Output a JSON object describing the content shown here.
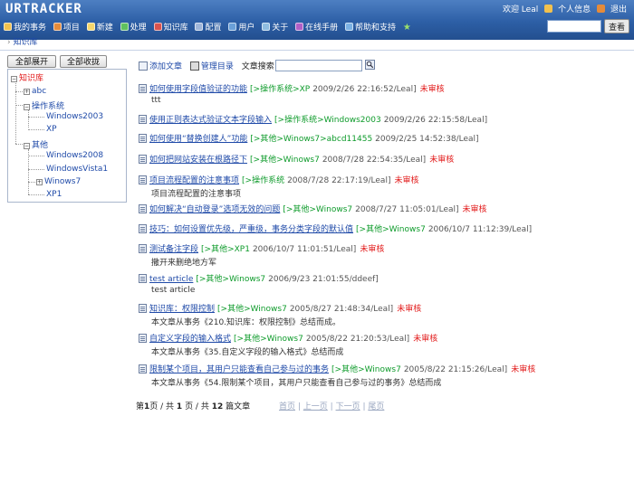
{
  "app": {
    "logo": "URTRACKER"
  },
  "userbar": {
    "welcome": "欢迎 Leal",
    "profile": "个人信息",
    "logout": "退出"
  },
  "nav": [
    {
      "label": "我的事务",
      "color": "#f2c14e"
    },
    {
      "label": "项目",
      "color": "#e58b3a"
    },
    {
      "label": "新建",
      "color": "#f6d76b"
    },
    {
      "label": "处理",
      "color": "#5fc15f"
    },
    {
      "label": "知识库",
      "color": "#d9534f"
    },
    {
      "label": "配置",
      "color": "#9fb6d9"
    },
    {
      "label": "用户",
      "color": "#6aa0d8"
    },
    {
      "label": "关于",
      "color": "#8fbde0"
    },
    {
      "label": "在线手册",
      "color": "#b05fc7"
    },
    {
      "label": "帮助和支持",
      "color": "#7bb1e3"
    }
  ],
  "search": {
    "button": "查看",
    "value": ""
  },
  "breadcrumb": "知识库",
  "tree": {
    "expand_all": "全部展开",
    "collapse_all": "全部收拢",
    "root": "知识库",
    "n_abc": "abc",
    "n_os": "操作系统",
    "n_win2003": "Windows2003",
    "n_xp": "XP",
    "n_other": "其他",
    "n_win2008": "Windows2008",
    "n_vista": "WindowsVista1",
    "n_win7": "Winows7",
    "n_xp1": "XP1"
  },
  "toolbar": {
    "add_article": "添加文章",
    "manage_dir": "管理目录",
    "search_label": "文章搜索",
    "search_value": ""
  },
  "articles": [
    {
      "title": "如何使用字段值验证的功能",
      "category": "[>操作系统>XP",
      "meta": "2009/2/26 22:16:52/Leal]",
      "status": "未审核",
      "desc": "ttt"
    },
    {
      "title": "使用正则表达式验证文本字段输入",
      "category": "[>操作系统>Windows2003",
      "meta": "2009/2/26 22:15:58/Leal]",
      "status": "",
      "desc": ""
    },
    {
      "title": "如何使用“替换创建人”功能",
      "category": "[>其他>Winows7>abcd11455",
      "meta": "2009/2/25 14:52:38/Leal]",
      "status": "",
      "desc": ""
    },
    {
      "title": "如何把网站安装在根路径下",
      "category": "[>其他>Winows7",
      "meta": "2008/7/28 22:54:35/Leal]",
      "status": "未审核",
      "desc": ""
    },
    {
      "title": "项目流程配置的注意事项",
      "category": "[>操作系统",
      "meta": "2008/7/28 22:17:19/Leal]",
      "status": "未审核",
      "desc": "项目流程配置的注意事项"
    },
    {
      "title": "如何解决“自动登录”选项无效的问题",
      "category": "[>其他>Winows7",
      "meta": "2008/7/27 11:05:01/Leal]",
      "status": "未审核",
      "desc": ""
    },
    {
      "title": "技巧：如何设置优先级，严重级，事务分类字段的默认值",
      "category": "[>其他>Winows7",
      "meta": "2006/10/7 11:12:39/Leal]",
      "status": "",
      "desc": ""
    },
    {
      "title": "测试备注字段",
      "category": "[>其他>XP1",
      "meta": "2006/10/7 11:01:51/Leal]",
      "status": "未审核",
      "desc": "撒开来删绝地方军"
    },
    {
      "title": "test article",
      "category": "[>其他>Winows7",
      "meta": "2006/9/23 21:01:55/ddeef]",
      "status": "",
      "desc": "test article"
    },
    {
      "title": "知识库：权限控制",
      "category": "[>其他>Winows7",
      "meta": "2005/8/27 21:48:34/Leal]",
      "status": "未审核",
      "desc": "本文章从事务《210.知识库：权限控制》总结而成。"
    },
    {
      "title": "自定义字段的输入格式",
      "category": "[>其他>Winows7",
      "meta": "2005/8/22 21:20:53/Leal]",
      "status": "未审核",
      "desc": "本文章从事务《35.自定义字段的输入格式》总结而成"
    },
    {
      "title": "限制某个项目，其用户只能查看自己参与过的事务",
      "category": "[>其他>Winows7",
      "meta": "2005/8/22 21:15:26/Leal]",
      "status": "未审核",
      "desc": "本文章从事务《54.限制某个项目，其用户只能查看自己参与过的事务》总结而成"
    }
  ],
  "pager": {
    "p1": "第",
    "current": "1",
    "p2": "页 / 共",
    "total_pages": "1",
    "p3": "页 / 共",
    "total_articles": "12",
    "p4": "篇文章",
    "first": "首页",
    "prev": "上一页",
    "next": "下一页",
    "last": "尾页"
  }
}
